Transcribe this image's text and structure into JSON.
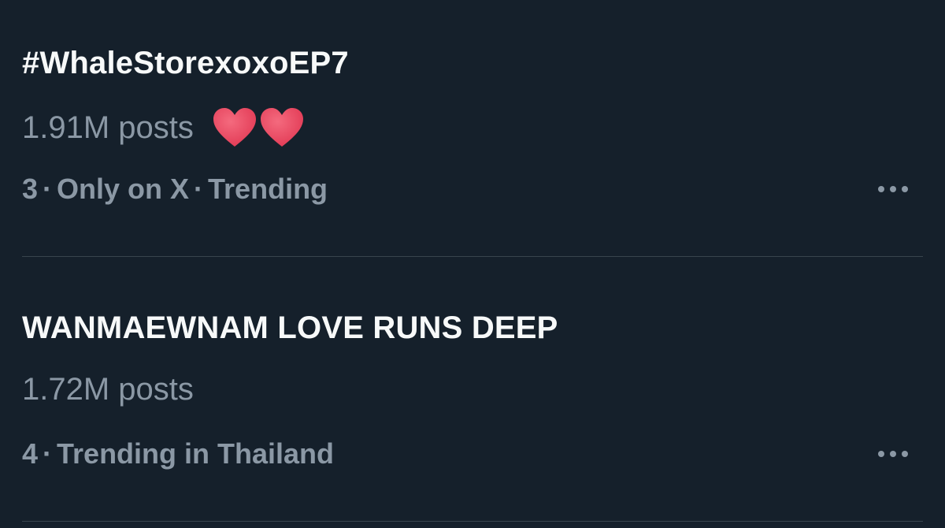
{
  "trends": [
    {
      "title": "#WhaleStorexoxoEP7",
      "posts": "1.91M posts",
      "rank": "3",
      "context": [
        "Only on X",
        "Trending"
      ],
      "emoji": [
        "heart-icon",
        "heart-icon"
      ]
    },
    {
      "title": "WANMAEWNAM LOVE RUNS DEEP",
      "posts": "1.72M posts",
      "rank": "4",
      "context": [
        "Trending in Thailand"
      ]
    }
  ],
  "separator": "·",
  "more_icon": "more-horizontal-icon",
  "colors": {
    "background": "#15202b",
    "title_text": "#f7f9f9",
    "secondary_text": "#8b98a5",
    "divider": "#38444d",
    "heart": "#e8475f"
  }
}
